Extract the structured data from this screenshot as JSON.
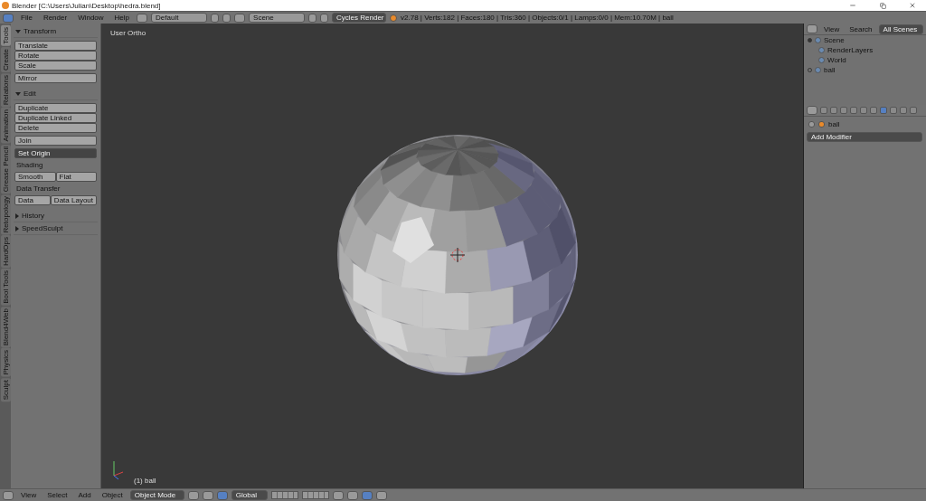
{
  "window": {
    "title": "Blender [C:\\Users\\Julian\\Desktop\\hedra.blend]"
  },
  "info_header": {
    "menu": [
      "File",
      "Render",
      "Window",
      "Help"
    ],
    "layout": "Default",
    "scene": "Scene",
    "engine": "Cycles Render",
    "stats": "v2.78 | Verts:182 | Faces:180 | Tris:360 | Objects:0/1 | Lamps:0/0 | Mem:10.70M | ball"
  },
  "tool_tabs": [
    {
      "label": "Tools",
      "selected": true
    },
    {
      "label": "Create",
      "selected": false
    },
    {
      "label": "Relations",
      "selected": false
    },
    {
      "label": "Animation",
      "selected": false
    },
    {
      "label": "Grease Pencil",
      "selected": false
    },
    {
      "label": "Retopology",
      "selected": false
    },
    {
      "label": "HardOps",
      "selected": false
    },
    {
      "label": "Bool Tools",
      "selected": false
    },
    {
      "label": "Blend4Web",
      "selected": false
    },
    {
      "label": "Physics",
      "selected": false
    },
    {
      "label": "Sculpt",
      "selected": false
    }
  ],
  "tool_panels": [
    {
      "title": "Transform",
      "expanded": true,
      "items": [
        {
          "kind": "stack",
          "labels": [
            "Translate",
            "Rotate",
            "Scale"
          ]
        },
        {
          "kind": "button",
          "label": "Mirror"
        }
      ]
    },
    {
      "title": "Edit",
      "expanded": true,
      "items": [
        {
          "kind": "stack",
          "labels": [
            "Duplicate",
            "Duplicate Linked",
            "Delete"
          ]
        },
        {
          "kind": "button",
          "label": "Join"
        },
        {
          "kind": "dropdown",
          "label": "Set Origin"
        },
        {
          "kind": "label",
          "label": "Shading"
        },
        {
          "kind": "row",
          "labels": [
            "Smooth",
            "Flat"
          ]
        },
        {
          "kind": "label",
          "label": "Data Transfer"
        },
        {
          "kind": "row",
          "labels": [
            "Data",
            "Data Layout"
          ]
        }
      ]
    },
    {
      "title": "History",
      "expanded": false
    },
    {
      "title": "SpeedSculpt",
      "expanded": false
    }
  ],
  "viewport": {
    "view_name": "User Ortho",
    "object_label": "(1) ball"
  },
  "outliner": {
    "menu": [
      "View",
      "Search"
    ],
    "filter": "All Scenes",
    "tree": [
      {
        "label": "Scene",
        "expanded": true,
        "children": [
          {
            "label": "RenderLayers"
          },
          {
            "label": "World"
          }
        ]
      },
      {
        "label": "ball",
        "expanded": false
      }
    ]
  },
  "properties": {
    "tabs": [
      {
        "selected": false
      },
      {
        "selected": false
      },
      {
        "selected": false
      },
      {
        "selected": false
      },
      {
        "selected": false
      },
      {
        "selected": false
      },
      {
        "selected": true
      },
      {
        "selected": false
      },
      {
        "selected": false
      },
      {
        "selected": false
      }
    ],
    "object": "ball",
    "action": "Add Modifier"
  },
  "view_header": {
    "menu": [
      "View",
      "Select",
      "Add",
      "Object"
    ],
    "mode": "Object Mode",
    "orientation": "Global"
  }
}
